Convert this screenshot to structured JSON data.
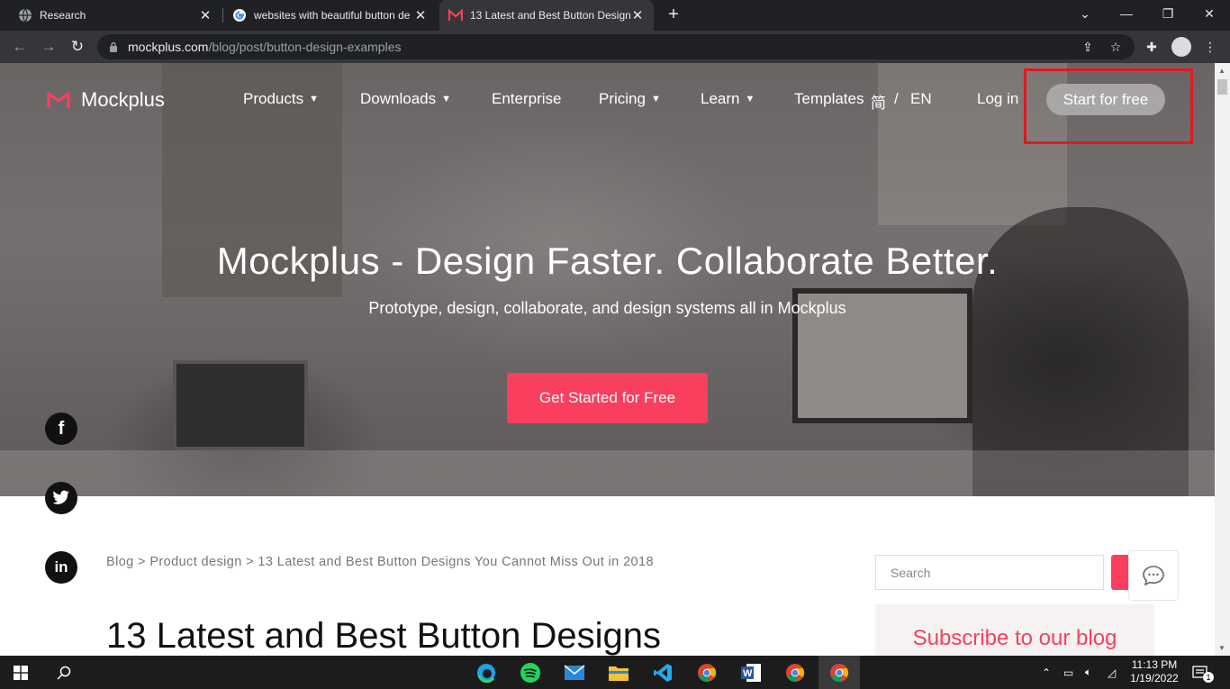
{
  "browser": {
    "tabs": [
      {
        "title": "Research",
        "icon": "globe-icon",
        "active": false
      },
      {
        "title": "websites with beautiful button de",
        "icon": "google-icon",
        "active": false
      },
      {
        "title": "13 Latest and Best Button Design",
        "icon": "mockplus-icon",
        "active": true
      }
    ],
    "new_tab": "+",
    "url_host": "mockplus.com",
    "url_path": "/blog/post/button-design-examples"
  },
  "site": {
    "logo_text": "Mockplus",
    "nav": {
      "products": "Products",
      "downloads": "Downloads",
      "enterprise": "Enterprise",
      "pricing": "Pricing",
      "learn": "Learn",
      "templates": "Templates",
      "lang_cn": "简",
      "lang_sep": "/",
      "lang_en": "EN",
      "login": "Log in",
      "start": "Start for free"
    },
    "hero": {
      "title": "Mockplus - Design Faster. Collaborate Better.",
      "subtitle": "Prototype, design, collaborate, and design systems all in Mockplus",
      "cta": "Get Started for Free"
    },
    "social": {
      "facebook": "f",
      "linkedin": "in"
    },
    "breadcrumb": "Blog > Product design > 13 Latest and Best Button Designs You Cannot Miss Out in 2018",
    "article_title": "13 Latest and Best Button Designs",
    "sidebar": {
      "search_placeholder": "Search",
      "subscribe": "Subscribe to our blog"
    },
    "colors": {
      "brand": "#fa3f5e",
      "highlight": "#e0191f"
    }
  },
  "taskbar": {
    "time": "11:13 PM",
    "date": "1/19/2022",
    "notifications": "1"
  }
}
